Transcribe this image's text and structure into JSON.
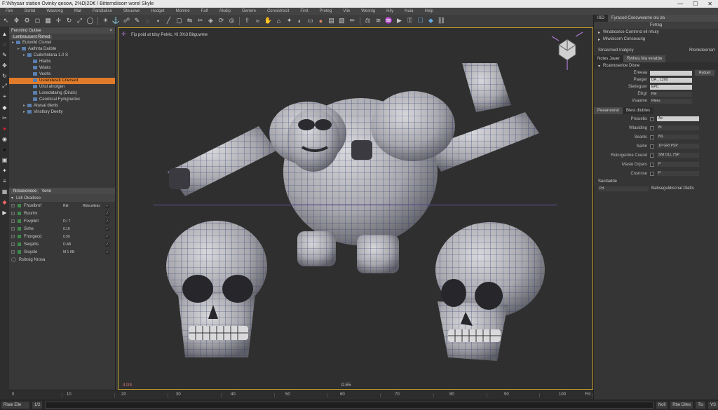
{
  "window": {
    "title": "F:\\Nhysair station Ovinky qesow, 2%D|2D€ / Bitterndiisorr worel Skyle",
    "controls": [
      "—",
      "☐",
      "✕"
    ]
  },
  "menu": [
    "Fire",
    "Sortat",
    "Waskreg",
    "Mat",
    "Pandtalise",
    "Steuuwe",
    "Hodget",
    "Monme",
    "Falf",
    "Alsdip",
    "Genere",
    "Consistrecit",
    "Finit",
    "Preteg",
    "Viie",
    "Wesnig",
    "Hily",
    "Nuia",
    "Help"
  ],
  "toolbar": {
    "icons": [
      "cursor-icon",
      "move-icon",
      "gear-icon",
      "cube-icon",
      "grid-icon",
      "gizmo-icon",
      "rotate-icon",
      "scale-icon",
      "sphere-icon",
      "lamp-icon",
      "anchor-icon",
      "bone-icon",
      "brush-icon",
      "lasso-icon",
      "vertex-icon",
      "edge-icon",
      "face-icon",
      "mirror-icon",
      "knife-icon",
      "bevel-icon",
      "loop-icon",
      "ring-icon",
      "extrude-icon",
      "smooth-icon",
      "sculpt-icon",
      "camera-icon",
      "light-icon",
      "render-icon",
      "frame-icon",
      "material-icon",
      "texture-icon",
      "uv-icon",
      "paint-icon",
      "weight-icon",
      "cloth-icon",
      "fluid-icon",
      "play-icon",
      "key-icon",
      "box-icon",
      "tint-icon",
      "link-icon"
    ]
  },
  "outliner": {
    "header": "Fenmlnd Outlee",
    "tabs": [
      "Lenbraucent Rimed"
    ],
    "items": [
      {
        "label": "Eulonlid Cismel",
        "indent": 0,
        "sel": false
      },
      {
        "label": "Aalhnta Daitsle",
        "indent": 1,
        "sel": false
      },
      {
        "label": "Cuilsrhnlana 1.0 S",
        "indent": 2,
        "sel": false
      },
      {
        "label": "Hlaibs",
        "indent": 3,
        "sel": false
      },
      {
        "label": "Wiaks",
        "indent": 3,
        "sel": false
      },
      {
        "label": "Veolts",
        "indent": 3,
        "sel": false
      },
      {
        "label": "Usrendesdt Cnersed",
        "indent": 3,
        "sel": true
      },
      {
        "label": "Uhsl alnolgen",
        "indent": 3,
        "sel": false
      },
      {
        "label": "Losedatalng (Dirals)",
        "indent": 3,
        "sel": false
      },
      {
        "label": "Ceorikcal Fymgnerlex",
        "indent": 3,
        "sel": false
      },
      {
        "label": "Atwsal dlenls",
        "indent": 2,
        "sel": false
      },
      {
        "label": "Vinstlory Deelty",
        "indent": 2,
        "sel": false
      }
    ]
  },
  "attributes": {
    "tabs": [
      "Nrsseionoce",
      "Verie"
    ],
    "header": "Lldl Okadsee",
    "rows": [
      {
        "label": "Fhcelbrnf",
        "value": "Rbl",
        "extra": "Rbhcelleds"
      },
      {
        "label": "Ruorlnr",
        "value": "",
        "extra": ""
      },
      {
        "label": "Fovplint",
        "value": "D.I 7",
        "extra": ""
      },
      {
        "label": "Sirhe",
        "value": "0.10",
        "extra": ""
      },
      {
        "label": "Fnorgecd",
        "value": "0.50",
        "extra": ""
      },
      {
        "label": "Seqallis",
        "value": "D.A8",
        "extra": ""
      },
      {
        "label": "Siuysle",
        "value": "M 1 KB",
        "extra": ""
      }
    ],
    "footer": "Rsitrsig Nrosa"
  },
  "viewport": {
    "label": "Fip poid at tdsy Pelvic, KI 3%3 Bitguwme",
    "bottom_left": "3 DS",
    "bottom_center": "D.E5"
  },
  "timeline": {
    "ticks": [
      "0",
      "10",
      "20",
      "30",
      "40",
      "50",
      "60",
      "70",
      "80",
      "90",
      "100"
    ],
    "end": "Flil"
  },
  "cmdline": {
    "left": "Rlaie Elle",
    "buttons": [
      "1/2",
      "Noll",
      "Rbe Dlles",
      "Tis",
      "VS"
    ]
  },
  "right_panel": {
    "header_tab": "ISD",
    "header_title": "Fyracod Coecwwarne olu da",
    "section1": "Fetrag",
    "list": [
      "Wnaboarce Contrrnd ell nhuty",
      "Miwislcorn Consesurig"
    ],
    "section2_left": "Smasrnwd Inatgicy",
    "section2_right": "Rtonkdeerrarr",
    "hdr2_left": "Nctes Jauer",
    "hdr2_right": "Rwheu Ma veratbe",
    "sub": "Rcatnoserioe Disne",
    "fields": [
      {
        "k": "Ereeaa",
        "v": "",
        "btn": "Ruduer"
      },
      {
        "k": "Paeger",
        "v": "DA _ 1200",
        "btn": ""
      },
      {
        "k": "Sietieguer",
        "v": "EPC",
        "btn": ""
      },
      {
        "k": "Elkgr",
        "v": "Rle",
        "btn": ""
      },
      {
        "k": "Vsaame",
        "v": "Rlees",
        "btn": ""
      }
    ],
    "tabs2": [
      "Peeaneoret",
      "Biest diubles"
    ],
    "fields2": [
      {
        "k": "Pnsuebs",
        "v": "As"
      },
      {
        "k": "Wlaslding",
        "v": "Bi"
      },
      {
        "k": "Seanls",
        "v": "BIL"
      },
      {
        "k": "Saihn",
        "v": "1P  GRI PSP"
      },
      {
        "k": "Rolorgenine Coend",
        "v": "SNI  OLL 7SP"
      },
      {
        "k": "Maste Drpars",
        "v": "P"
      },
      {
        "k": "Cnsnnse",
        "v": "P"
      }
    ],
    "bottom_label": "Sacdadde",
    "bottom_field": "Pd",
    "bottom_value": "Babseguldiscnal Dlatts"
  }
}
